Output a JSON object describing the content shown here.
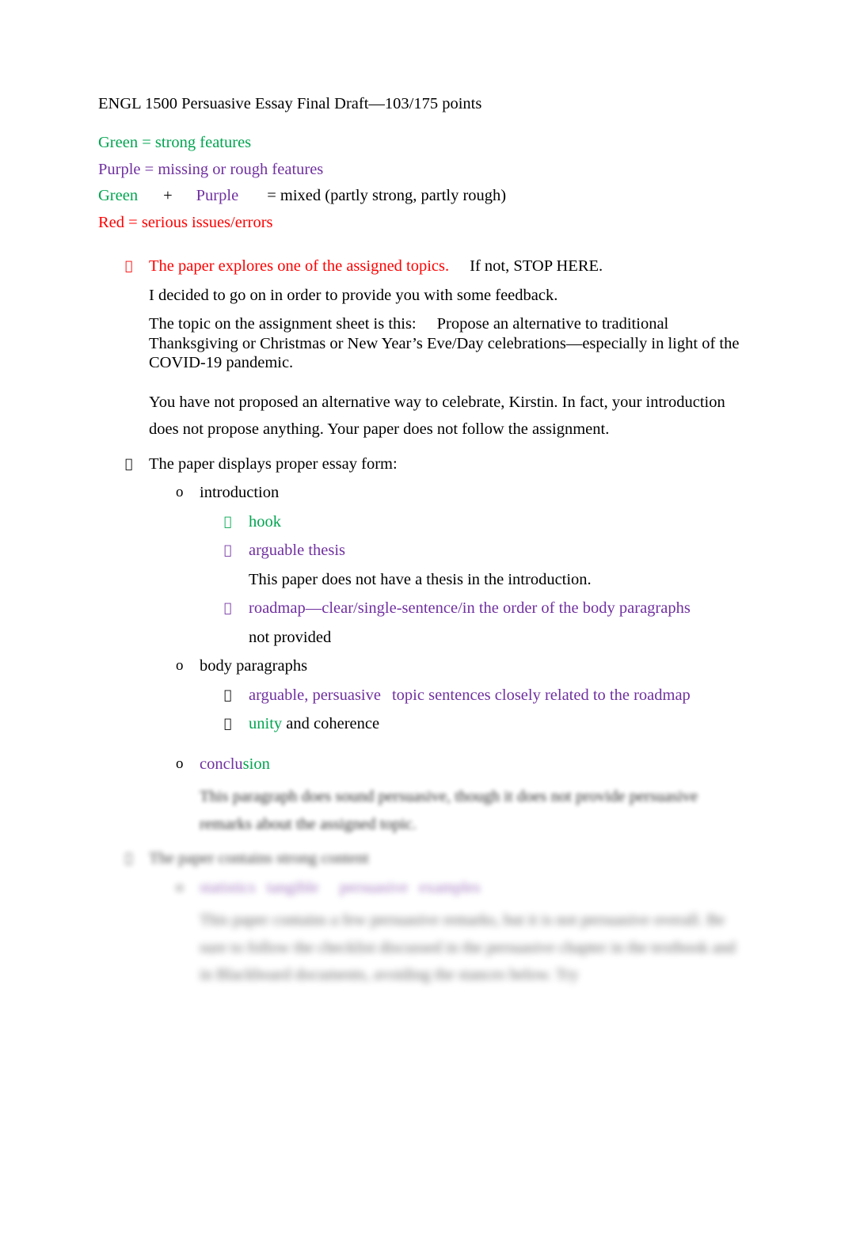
{
  "document": {
    "title": "ENGL 1500 Persuasive Essay Final Draft—103/175 points"
  },
  "colors": {
    "green": "#00a550",
    "purple": "#7030a0",
    "red": "#ff0000",
    "black": "#000000"
  },
  "legend": {
    "green_line": {
      "label": "Green",
      "text": " = strong features"
    },
    "purple_line": {
      "label": "Purple",
      "text": " = missing or rough features"
    },
    "mixed_line": {
      "green": "Green",
      "plus": "+",
      "purple": "Purple",
      "text": "= mixed (partly strong, partly rough)"
    },
    "red_line": {
      "label": "Red",
      "text": " = serious issues/errors"
    }
  },
  "bullets": {
    "glyph_level1": "",
    "glyph_level2": "o",
    "glyph_level3": ""
  },
  "criteria": [
    {
      "id": "topic",
      "bullet_text_red": "The paper explores one of the assigned topics.",
      "bullet_text_black": "If not, STOP HERE.",
      "notes": [
        "I decided to go on in order to provide you with some feedback.",
        "The topic on the assignment sheet is this:",
        "Propose an alternative to traditional Thanksgiving or Christmas or New Year’s Eve/Day celebrations—especially in light of the COVID-19 pandemic.",
        "You have not proposed an alternative way to celebrate, Kirstin. In fact, your introduction does not propose anything. Your paper does not follow the assignment."
      ]
    },
    {
      "id": "essay-form",
      "heading": "The paper displays proper essay form:",
      "sections": [
        {
          "label": "introduction",
          "items": [
            {
              "text": "hook",
              "color": "green"
            },
            {
              "text": "arguable thesis",
              "color": "purple",
              "note": "This paper does not have a thesis in the introduction."
            },
            {
              "text": "roadmap—clear/single-sentence/in the order of the body paragraphs",
              "color": "purple",
              "note": "not provided"
            }
          ]
        },
        {
          "label": "body paragraphs",
          "items": [
            {
              "text_a": "arguable, persuasive",
              "text_b": "topic sentences closely related to the roadmap",
              "color": "purple"
            },
            {
              "text_a": "unity",
              "text_b": " and coherence",
              "color": "mixed"
            }
          ]
        },
        {
          "label": "conclusion",
          "label_part_purple": "conclu",
          "label_part_green": "sion",
          "note_visible": "This",
          "note_obscured": "paragraph does sound persuasive, though it does not provide persuasive remarks about the assigned topic."
        }
      ]
    },
    {
      "id": "strong-content",
      "heading_obscured": "The paper contains strong content",
      "items": [
        {
          "text_obscured_a": "statistics",
          "text_obscured_b": "tangible",
          "text_obscured_c": "persuasive",
          "text_obscured_d": "examples",
          "color": "purple"
        }
      ],
      "note_obscured": [
        "This paper contains a few persuasive remarks, but it is not persuasive overall. Be sure to follow the checklist discussed in the persuasive chapter in the textbook and in Blackboard documents, avoiding the stances below. Try"
      ]
    }
  ]
}
